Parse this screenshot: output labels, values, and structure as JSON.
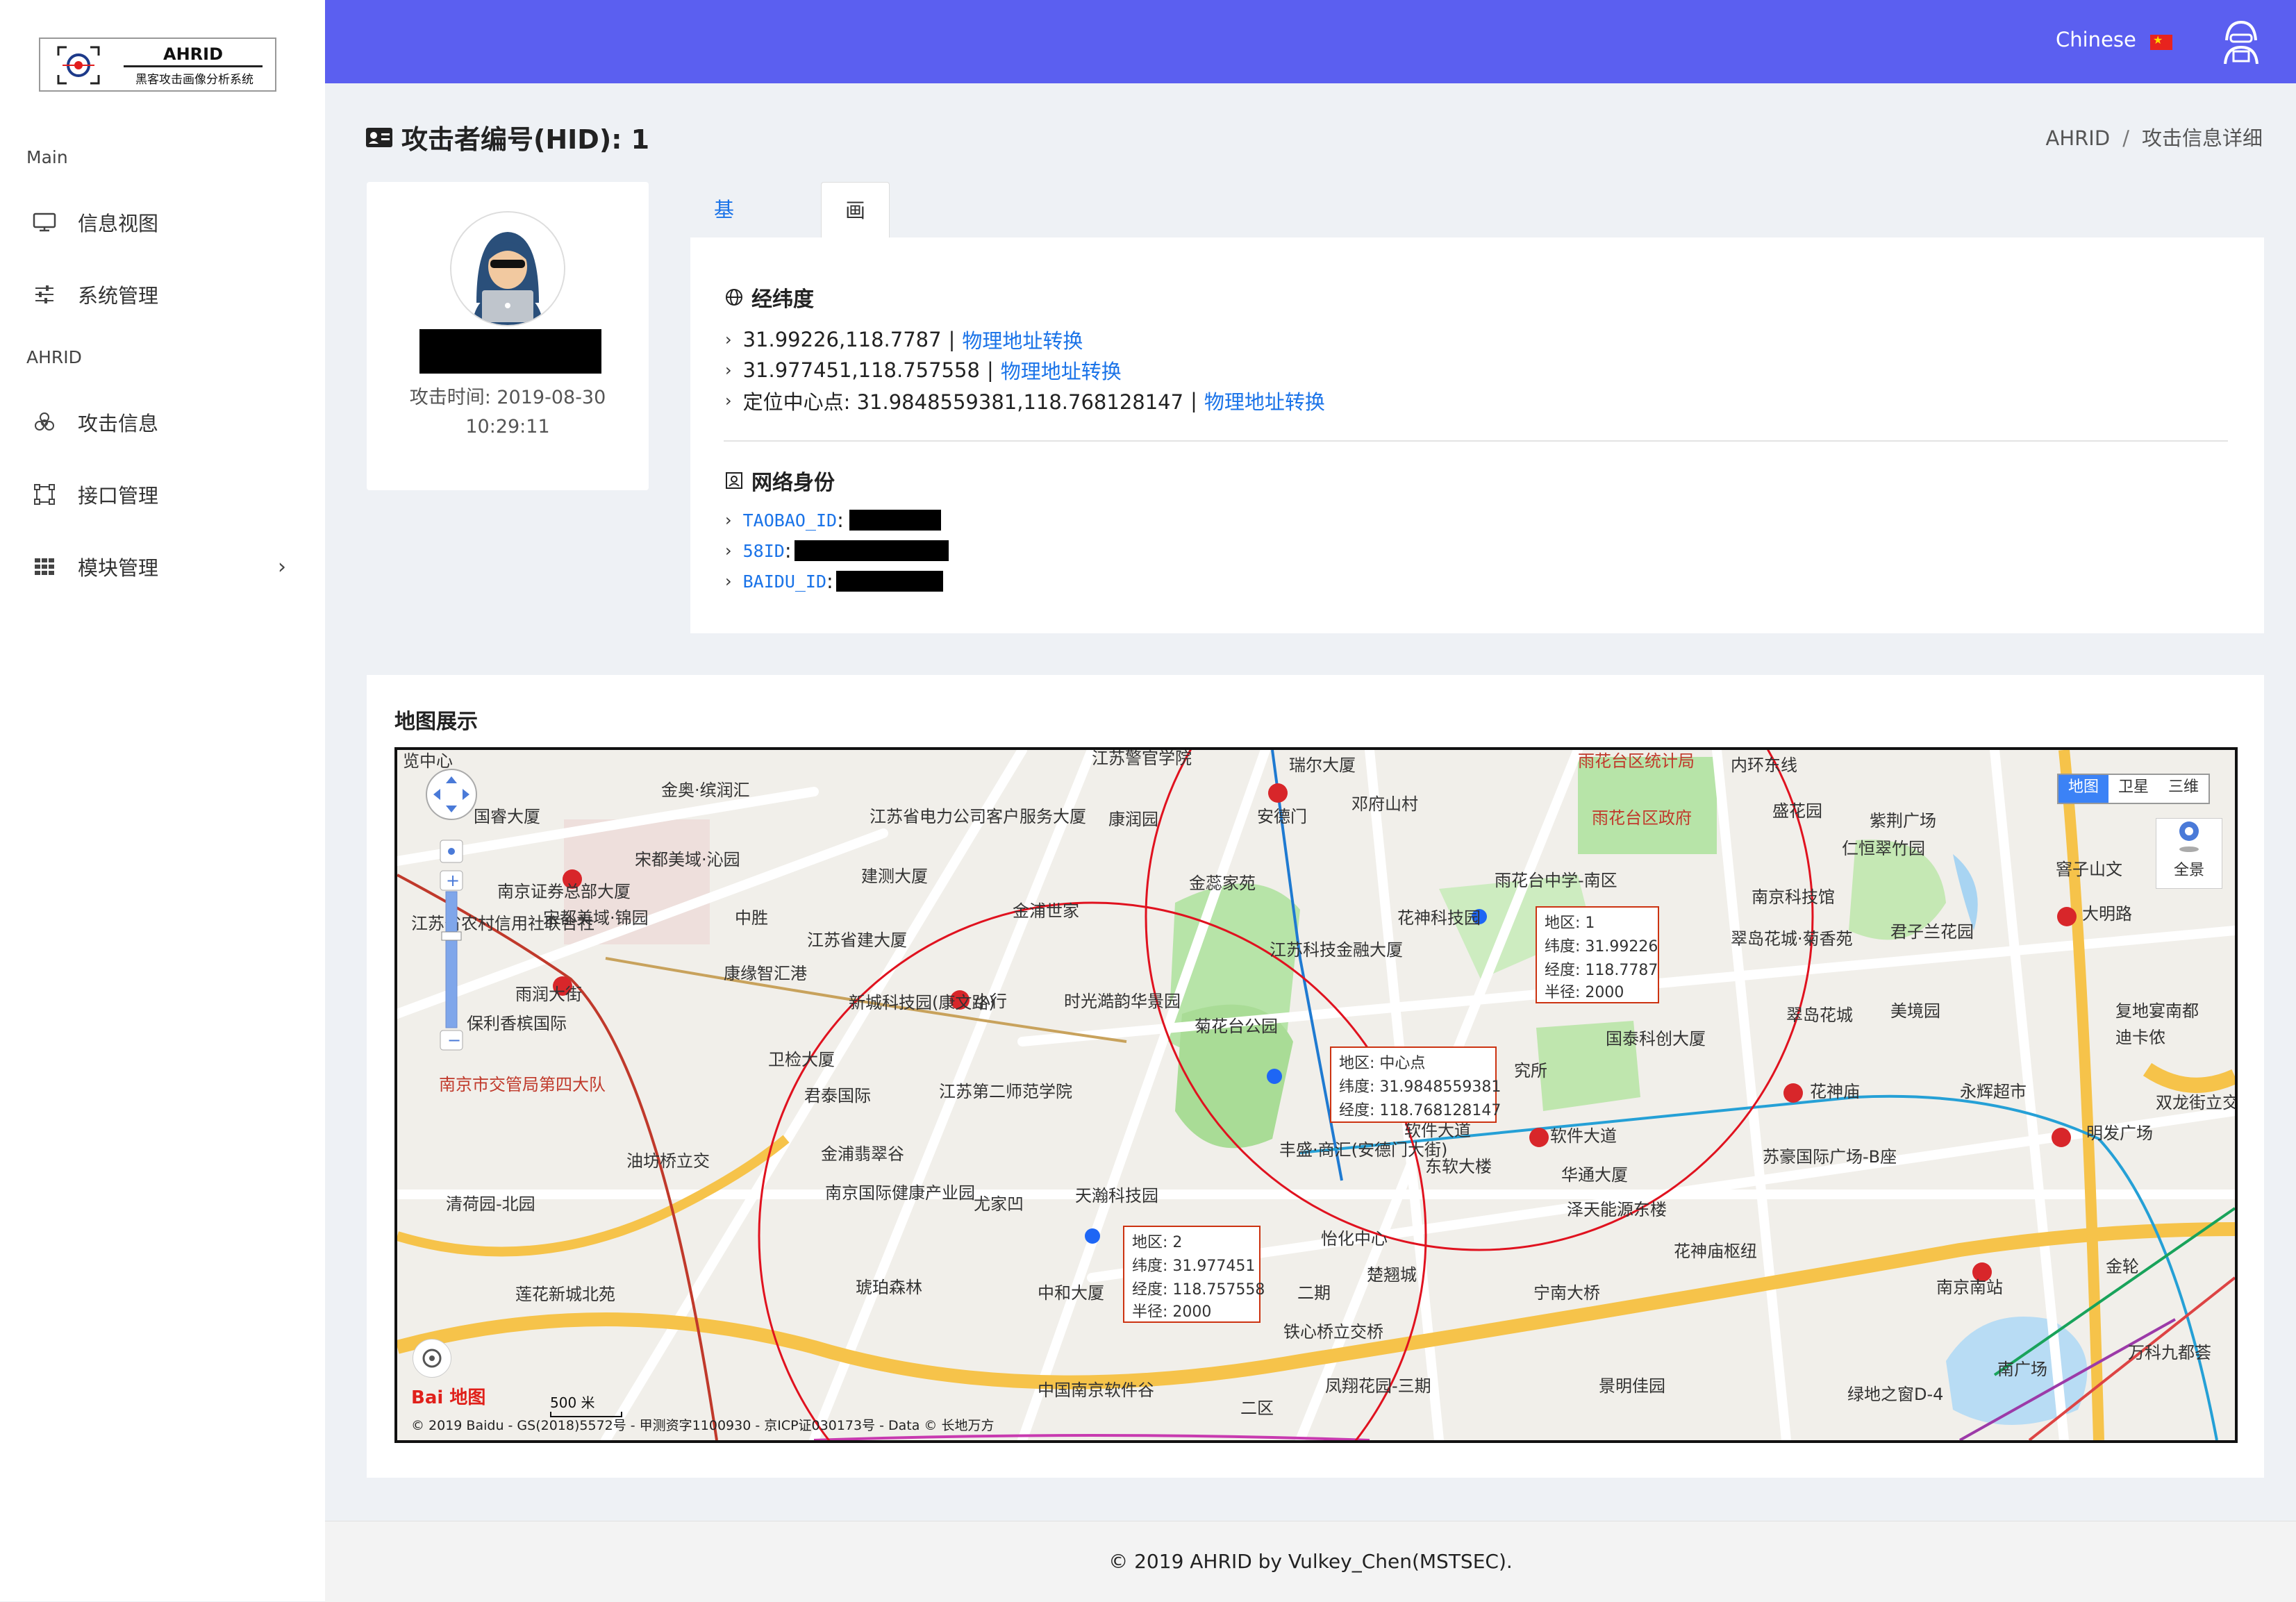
{
  "app": {
    "logo_title": "AHRID",
    "logo_subtitle": "黑客攻击画像分析系统"
  },
  "sidebar": {
    "sections": [
      {
        "label": "Main"
      },
      {
        "label": "AHRID"
      }
    ],
    "items": [
      {
        "label": "信息视图",
        "icon": "monitor-icon"
      },
      {
        "label": "系统管理",
        "icon": "sliders-icon"
      },
      {
        "label": "攻击信息",
        "icon": "biohazard-icon"
      },
      {
        "label": "接口管理",
        "icon": "nodes-icon"
      },
      {
        "label": "模块管理",
        "icon": "grid-icon",
        "chevron": "›"
      }
    ]
  },
  "header": {
    "language": "Chinese"
  },
  "page": {
    "title": "攻击者编号(HID): 1",
    "breadcrumb": [
      "AHRID",
      "攻击信息详细"
    ],
    "breadcrumb_sep": "/"
  },
  "profile": {
    "attack_time": "攻击时间: 2019-08-30 10:29:11"
  },
  "tabs": [
    {
      "label": "基础信息",
      "active": false
    },
    {
      "label": "画像信息",
      "active": true
    }
  ],
  "geo": {
    "heading": "经纬度",
    "rows": [
      {
        "text": "31.99226,118.7787",
        "link": "物理地址转换"
      },
      {
        "text": "31.977451,118.757558",
        "link": "物理地址转换"
      },
      {
        "text": "定位中心点: 31.9848559381,118.768128147",
        "link": "物理地址转换"
      }
    ],
    "separator": "|"
  },
  "identity": {
    "heading": "网络身份",
    "rows": [
      {
        "key": "TAOBAO_ID"
      },
      {
        "key": "58ID"
      },
      {
        "key": "BAIDU_ID"
      }
    ],
    "colon": ":"
  },
  "map": {
    "title": "地图展示",
    "types": [
      "地图",
      "卫星",
      "三维"
    ],
    "active_type": "地图",
    "pano_label": "全景",
    "scale_label": "500 米",
    "copyright": "© 2019 Baidu - GS(2018)5572号 - 甲测资字1100930 - 京ICP证030173号 - Data © 长地万方",
    "baidu_logo": "Bai 地图",
    "popups": [
      {
        "lines": [
          "地区: 1",
          "纬度: 31.99226",
          "经度: 118.7787",
          "半径: 2000"
        ]
      },
      {
        "lines": [
          "地区: 中心点",
          "纬度: 31.9848559381",
          "经度: 118.768128147"
        ]
      },
      {
        "lines": [
          "地区: 2",
          "纬度: 31.977451",
          "经度: 118.757558",
          "半径: 2000"
        ]
      }
    ],
    "places": [
      "览中心",
      "金奥·缤润汇",
      "国睿大厦",
      "宋都美域·沁园",
      "南京证券总部大厦",
      "宋都美域·锦园",
      "中胜",
      "江苏省农村信用社联合社",
      "雨润大街",
      "保利香槟国际",
      "南京市交管局第四大队",
      "江苏警官学院",
      "江苏省电力公司客户服务大厦",
      "建测大厦",
      "江苏省建大厦",
      "康缘智汇港",
      "新城科技园(康文路)",
      "小行",
      "卫检大厦",
      "君泰国际",
      "江苏第二师范学院",
      "金浦翡翠谷",
      "南京国际健康产业园",
      "尤家凹",
      "油坊桥立交",
      "清荷园-北园",
      "莲花新城北苑",
      "琥珀森林",
      "瑞尔大厦",
      "安德门",
      "邓府山村",
      "康润园",
      "金蕊家苑",
      "金浦世家",
      "时光澔韵华景园",
      "江苏科技金融大厦",
      "菊花台公园",
      "花神科技园",
      "雨花台区统计局",
      "雨花台区政府",
      "雨花台中学-南区",
      "内环东线",
      "盛花园",
      "紫荆广场",
      "仁恒翠竹园",
      "南京科技馆",
      "翠岛花城·菊香苑",
      "君子兰花园",
      "翠岛花城",
      "美境园",
      "国泰科创大厦",
      "软件大道",
      "丰盛·商汇(安德门大街)",
      "东软大楼",
      "华通大厦",
      "泽天能源东楼",
      "花神庙枢纽",
      "宁南大桥",
      "景明佳园",
      "天瀚科技园",
      "中和大厦",
      "怡化中心",
      "楚翘城",
      "二期",
      "铁心桥立交桥",
      "凤翔花园-三期",
      "中国南京软件谷",
      "二区",
      "花神庙",
      "苏豪国际广场-B座",
      "永辉超市",
      "大明路",
      "复地宴南都",
      "迪卡侬",
      "明发广场",
      "双龙街立交桥",
      "窨子山文",
      "南京南站",
      "金轮",
      "万科九都荟",
      "南广场",
      "绿地之窗D-4",
      "软件大道",
      "究所"
    ]
  },
  "footer": {
    "text": "© 2019 AHRID by Vulkey_Chen(MSTSEC)."
  }
}
